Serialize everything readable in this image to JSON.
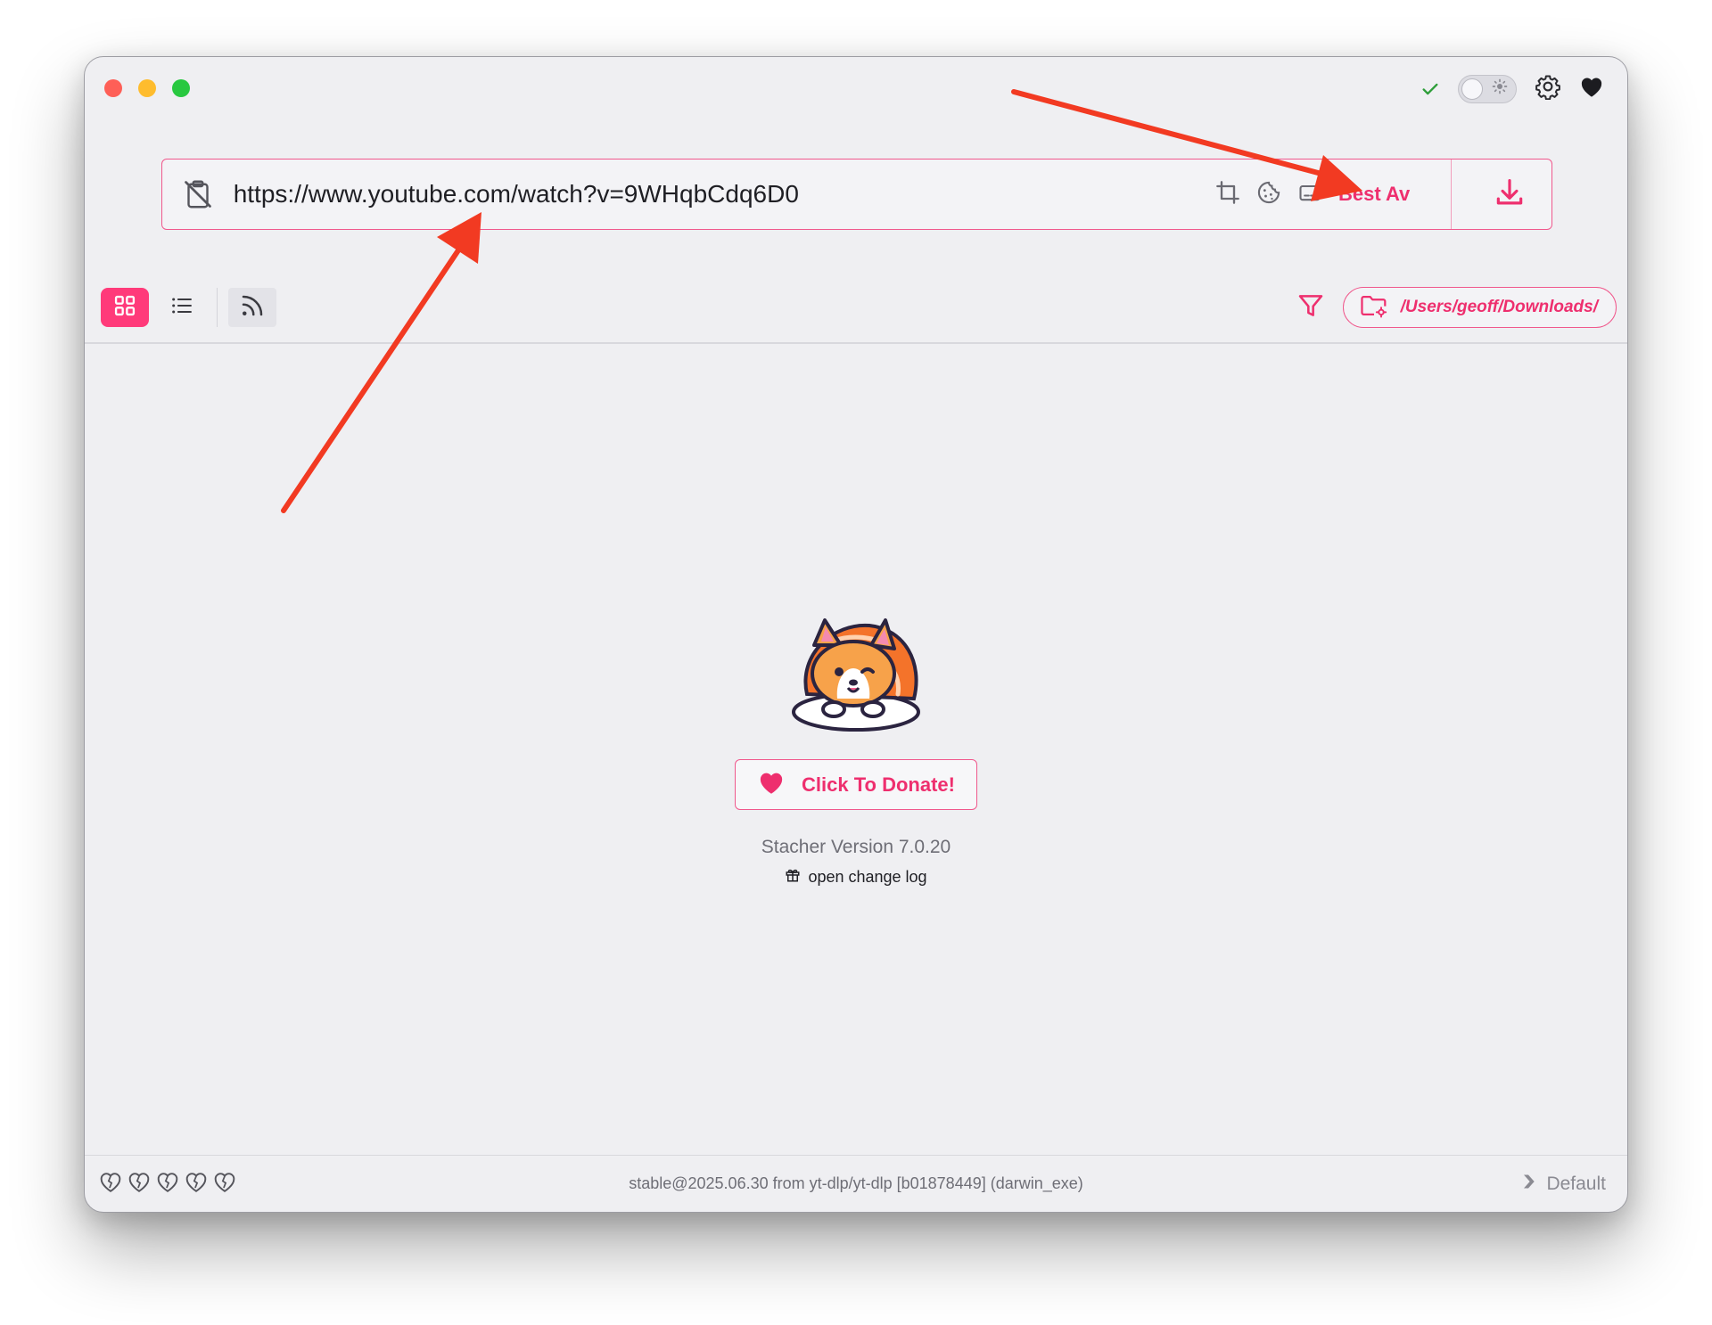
{
  "window": {
    "traffic_lights": [
      "close",
      "minimize",
      "zoom"
    ]
  },
  "header": {
    "icons": [
      "check-icon",
      "theme-toggle",
      "gear-icon",
      "heart-icon"
    ]
  },
  "url_bar": {
    "value": "https://www.youtube.com/watch?v=9WHqbCdq6D0",
    "format_label": "Best Av",
    "icons": [
      "clipboard-off-icon",
      "crop-icon",
      "cookie-icon",
      "subtitle-icon",
      "download-icon"
    ]
  },
  "toolbar": {
    "views": [
      "grid-view",
      "list-view",
      "rss-feed"
    ],
    "download_path": "/Users/geoff/Downloads/"
  },
  "main": {
    "donate_label": "Click To Donate!",
    "version_text": "Stacher Version 7.0.20",
    "changelog_label": "open change log"
  },
  "footer": {
    "status": "stable@2025.06.30 from yt-dlp/yt-dlp [b01878449] (darwin_exe)",
    "profile_label": "Default",
    "health_hearts": 5
  },
  "colors": {
    "accent": "#ee2f6e",
    "annotation_arrow": "#f23a22",
    "window_bg": "#efeff2"
  }
}
